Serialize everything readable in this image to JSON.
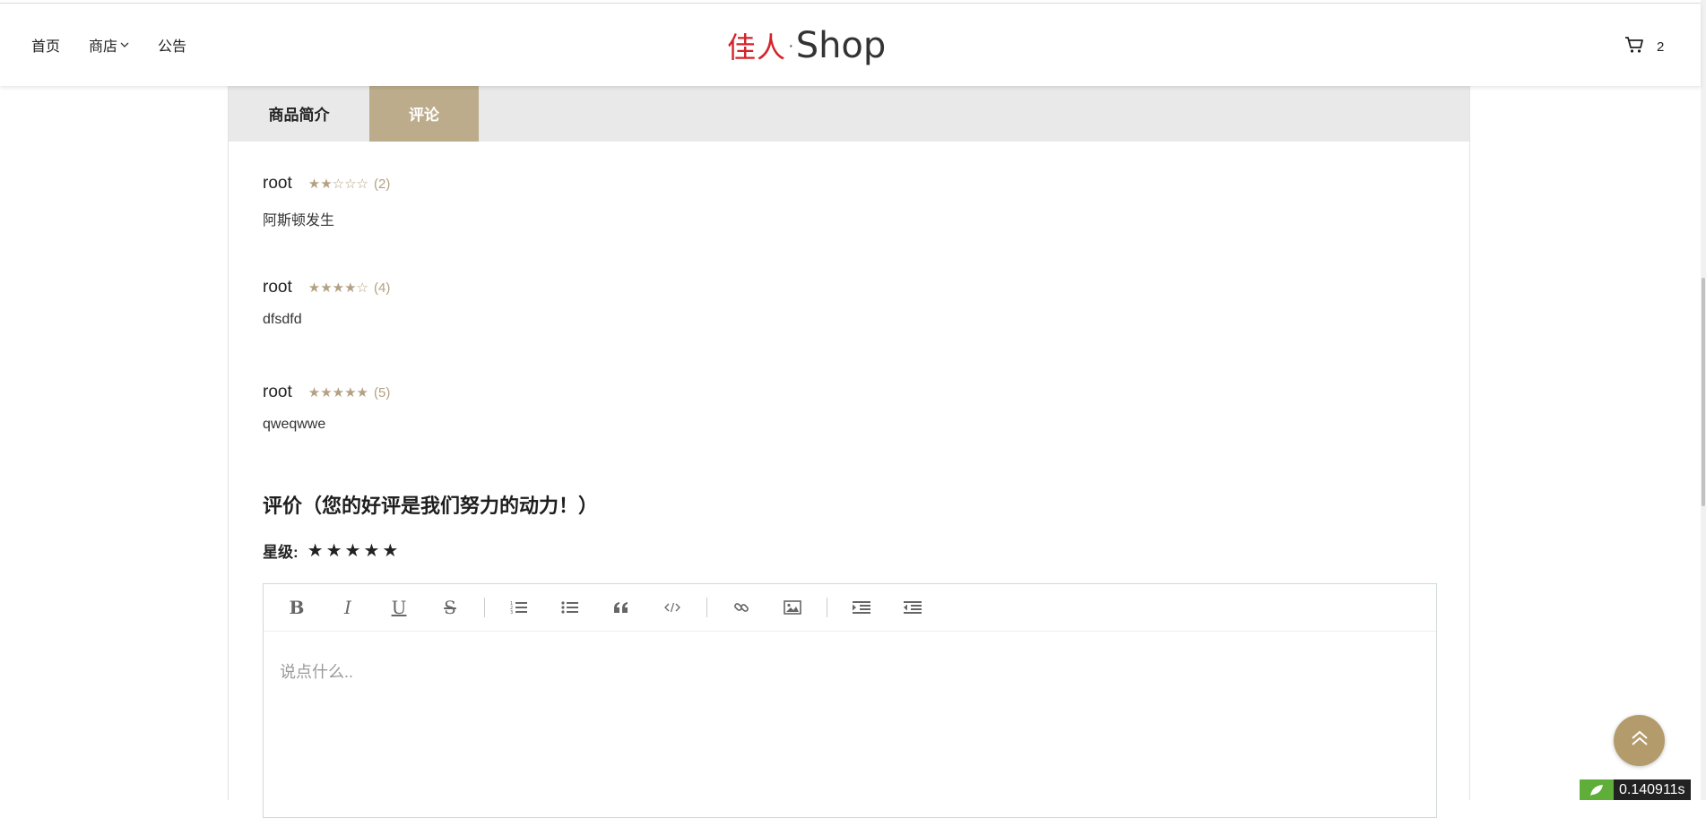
{
  "nav": {
    "items": [
      {
        "label": "首页",
        "has_dropdown": false
      },
      {
        "label": "商店",
        "has_dropdown": true
      },
      {
        "label": "公告",
        "has_dropdown": false
      }
    ],
    "logo": {
      "cn": "佳人",
      "dot": "·",
      "en": "Shop"
    },
    "cart_count": "2",
    "icons": {
      "cart": "cart-icon",
      "dropdown": "chevron-down-icon"
    }
  },
  "tabs": [
    {
      "label": "商品简介",
      "active": false
    },
    {
      "label": "评论",
      "active": true
    }
  ],
  "reviews": [
    {
      "user": "root",
      "stars": "★★☆☆☆",
      "rating": 2,
      "score": "(2)",
      "text": "阿斯顿发生"
    },
    {
      "user": "root",
      "stars": "★★★★☆",
      "rating": 4,
      "score": "(4)",
      "text": "dfsdfd"
    },
    {
      "user": "root",
      "stars": "★★★★★",
      "rating": 5,
      "score": "(5)",
      "text": "qweqwwe"
    }
  ],
  "form": {
    "title": "评价（您的好评是我们努力的动力！）",
    "rating_label": "星级:",
    "rating_stars": [
      "★",
      "★",
      "★",
      "★",
      "★"
    ],
    "placeholder": "说点什么.."
  },
  "editor_toolbar": [
    "bold",
    "italic",
    "underline",
    "strikethrough",
    "|",
    "ordered-list",
    "unordered-list",
    "quote",
    "code",
    "|",
    "link",
    "image",
    "|",
    "indent",
    "outdent"
  ],
  "timer": "0.140911s",
  "colors": {
    "accent": "#bcac8b",
    "brand_red": "#d4232b",
    "star": "#b3a183",
    "back_to_top": "#b39b6b"
  }
}
